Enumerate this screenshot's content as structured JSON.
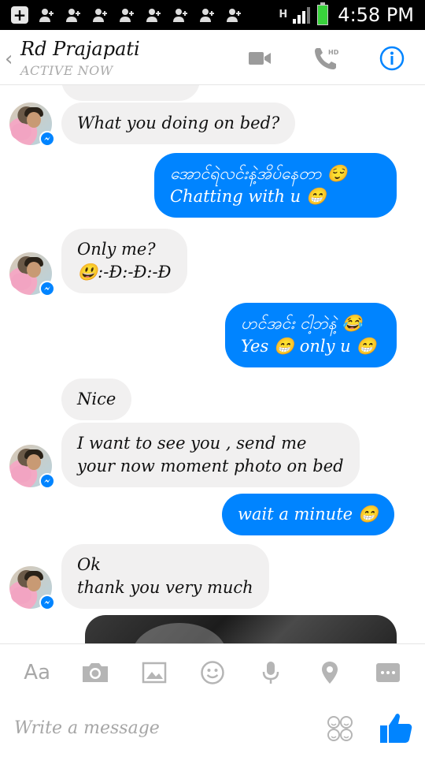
{
  "status_bar": {
    "network_label": "H",
    "time": "4:58 PM"
  },
  "header": {
    "contact_name": "Rd Prajapati",
    "status": "ACTIVE NOW",
    "hd_label": "HD"
  },
  "messages": [
    {
      "from": "them",
      "text": "What you doing on bed?"
    },
    {
      "from": "me",
      "text": "အောင်ရဲလင်းနဲ့အိပ်နေတာ 😌\nChatting with u 😁"
    },
    {
      "from": "them",
      "text": "Only me?\n😃:-Ð:-Ð:-Ð"
    },
    {
      "from": "me",
      "text": "ဟင်အင်း ငါ့ဘဲနဲ့ 😂\nYes 😁 only u 😁"
    },
    {
      "from": "them",
      "text": "Nice"
    },
    {
      "from": "them",
      "text": "I want to see you , send me\nyour now moment photo on bed"
    },
    {
      "from": "me",
      "text": "wait a minute 😁"
    },
    {
      "from": "them",
      "text": "Ok\nthank you very much"
    }
  ],
  "composer": {
    "aa_label": "Aa",
    "placeholder": "Write a message"
  },
  "colors": {
    "accent": "#0084ff",
    "received_bubble": "#f1f0f0",
    "status_bar": "#000000"
  }
}
